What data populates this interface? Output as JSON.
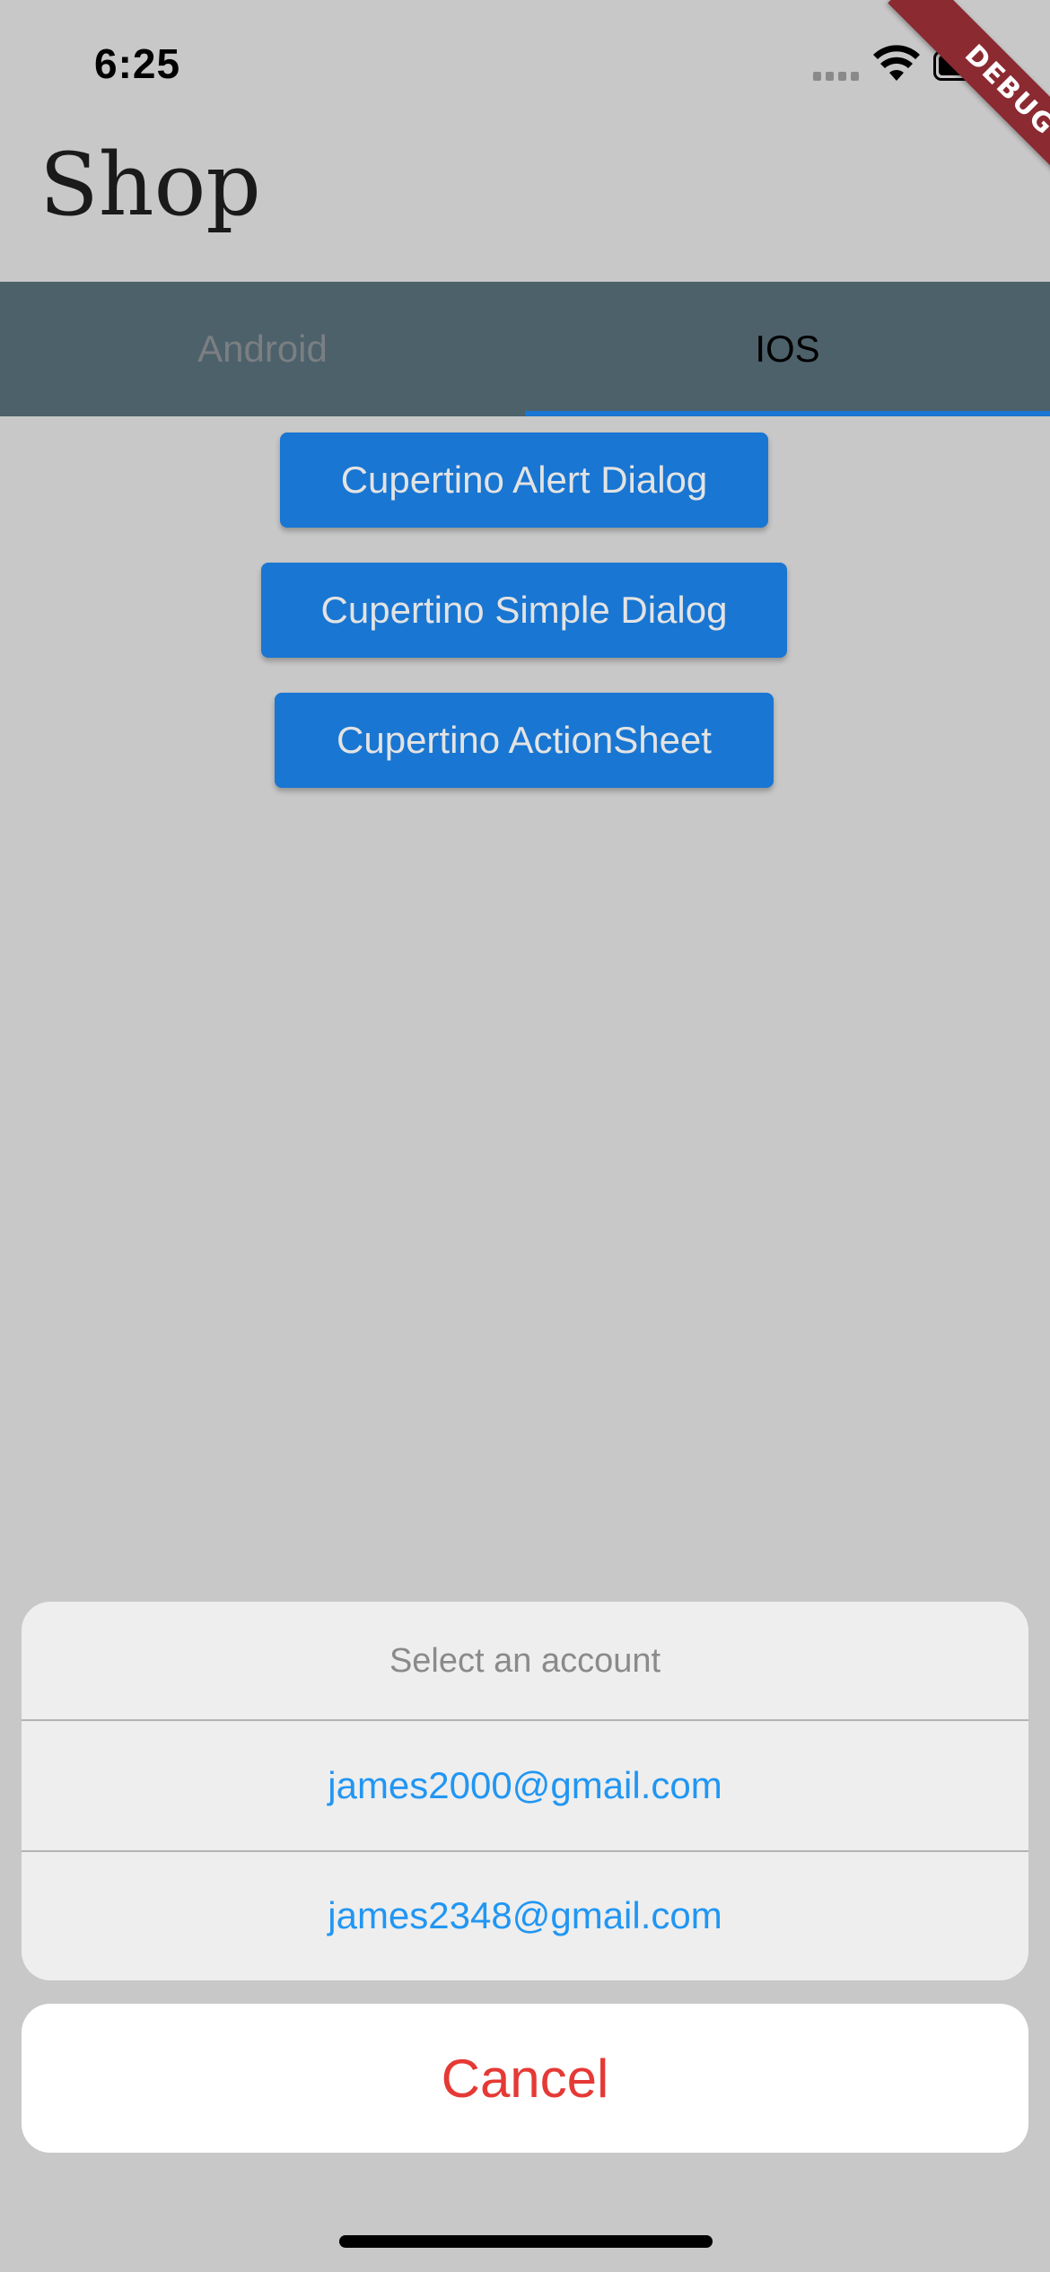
{
  "status_bar": {
    "time": "6:25"
  },
  "debug_banner": "DEBUG",
  "app_bar": {
    "title": "Shop"
  },
  "tabs": [
    {
      "label": "Android",
      "selected": false
    },
    {
      "label": "IOS",
      "selected": true
    }
  ],
  "buttons": {
    "alert_dialog": "Cupertino Alert Dialog",
    "simple_dialog": "Cupertino Simple Dialog",
    "action_sheet": "Cupertino ActionSheet"
  },
  "action_sheet": {
    "title": "Select an account",
    "actions": [
      "james2000@gmail.com",
      "james2348@gmail.com"
    ],
    "cancel": "Cancel"
  },
  "colors": {
    "accent": "#1976d2",
    "tab_bar": "#4d616b",
    "action_text": "#2196f3",
    "cancel_text": "#e53935"
  }
}
